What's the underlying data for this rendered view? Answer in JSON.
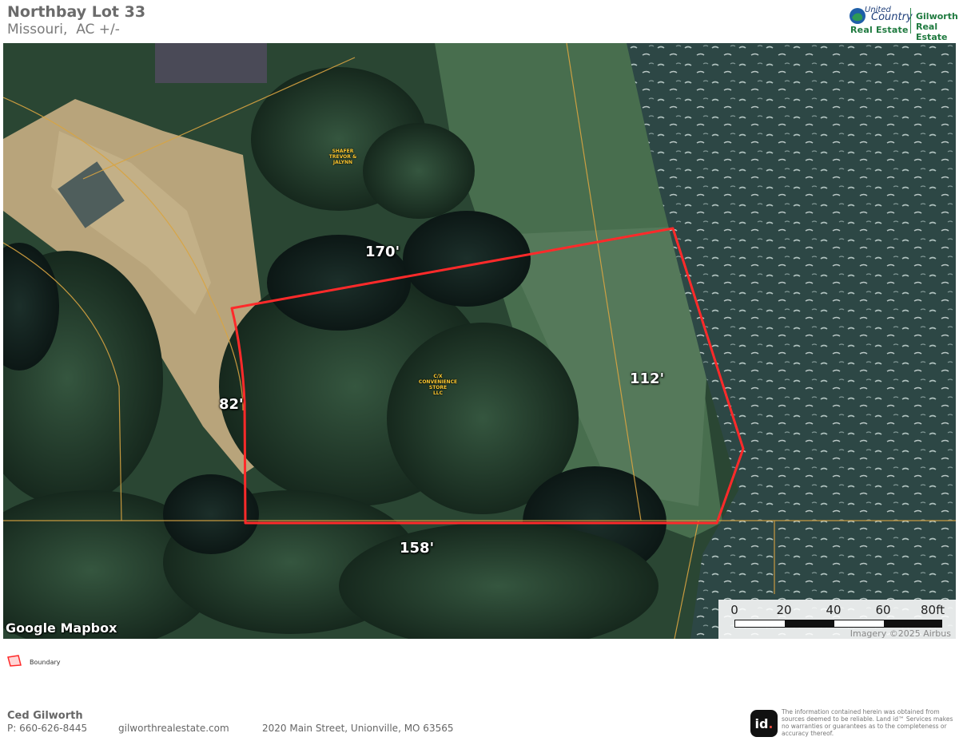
{
  "header": {
    "title": "Northbay Lot 33",
    "subtitle": "Missouri,  AC +/-"
  },
  "logo": {
    "united": "United",
    "country": "Country",
    "real_estate": "Real Estate",
    "gilworth": "Gilworth",
    "gilworth_re": "Real Estate"
  },
  "map": {
    "dimensions": {
      "top": "170'",
      "left": "82'",
      "right": "112'",
      "bottom": "158'"
    },
    "owners": {
      "north_parcel": "SHAFER\nTREVOR &\nJALYNN",
      "subject_parcel": "C/X\nCONVENIENCE\nSTORE\nLLC"
    },
    "credit": "Google Mapbox",
    "scale": {
      "labels": [
        "0",
        "20",
        "40",
        "60",
        "80ft"
      ]
    },
    "imagery": "Imagery ©2025 Airbus"
  },
  "legend": {
    "boundary_label": "Boundary"
  },
  "footer": {
    "agent_name": "Ced Gilworth",
    "phone": "P: 660-626-8445",
    "website": "gilworthrealestate.com",
    "address": "2020 Main Street, Unionville, MO  63565",
    "disclaimer": "The information contained herein was obtained from sources deemed to be reliable. Land id™ Services makes no warranties or guarantees as to the completeness or accuracy thereof."
  },
  "colors": {
    "boundary": "#ff2a2a",
    "parcel_lines": "#d9a441",
    "water": "#2f4a47",
    "trees": "#1f3a2a",
    "dirt": "#b9a57a"
  }
}
